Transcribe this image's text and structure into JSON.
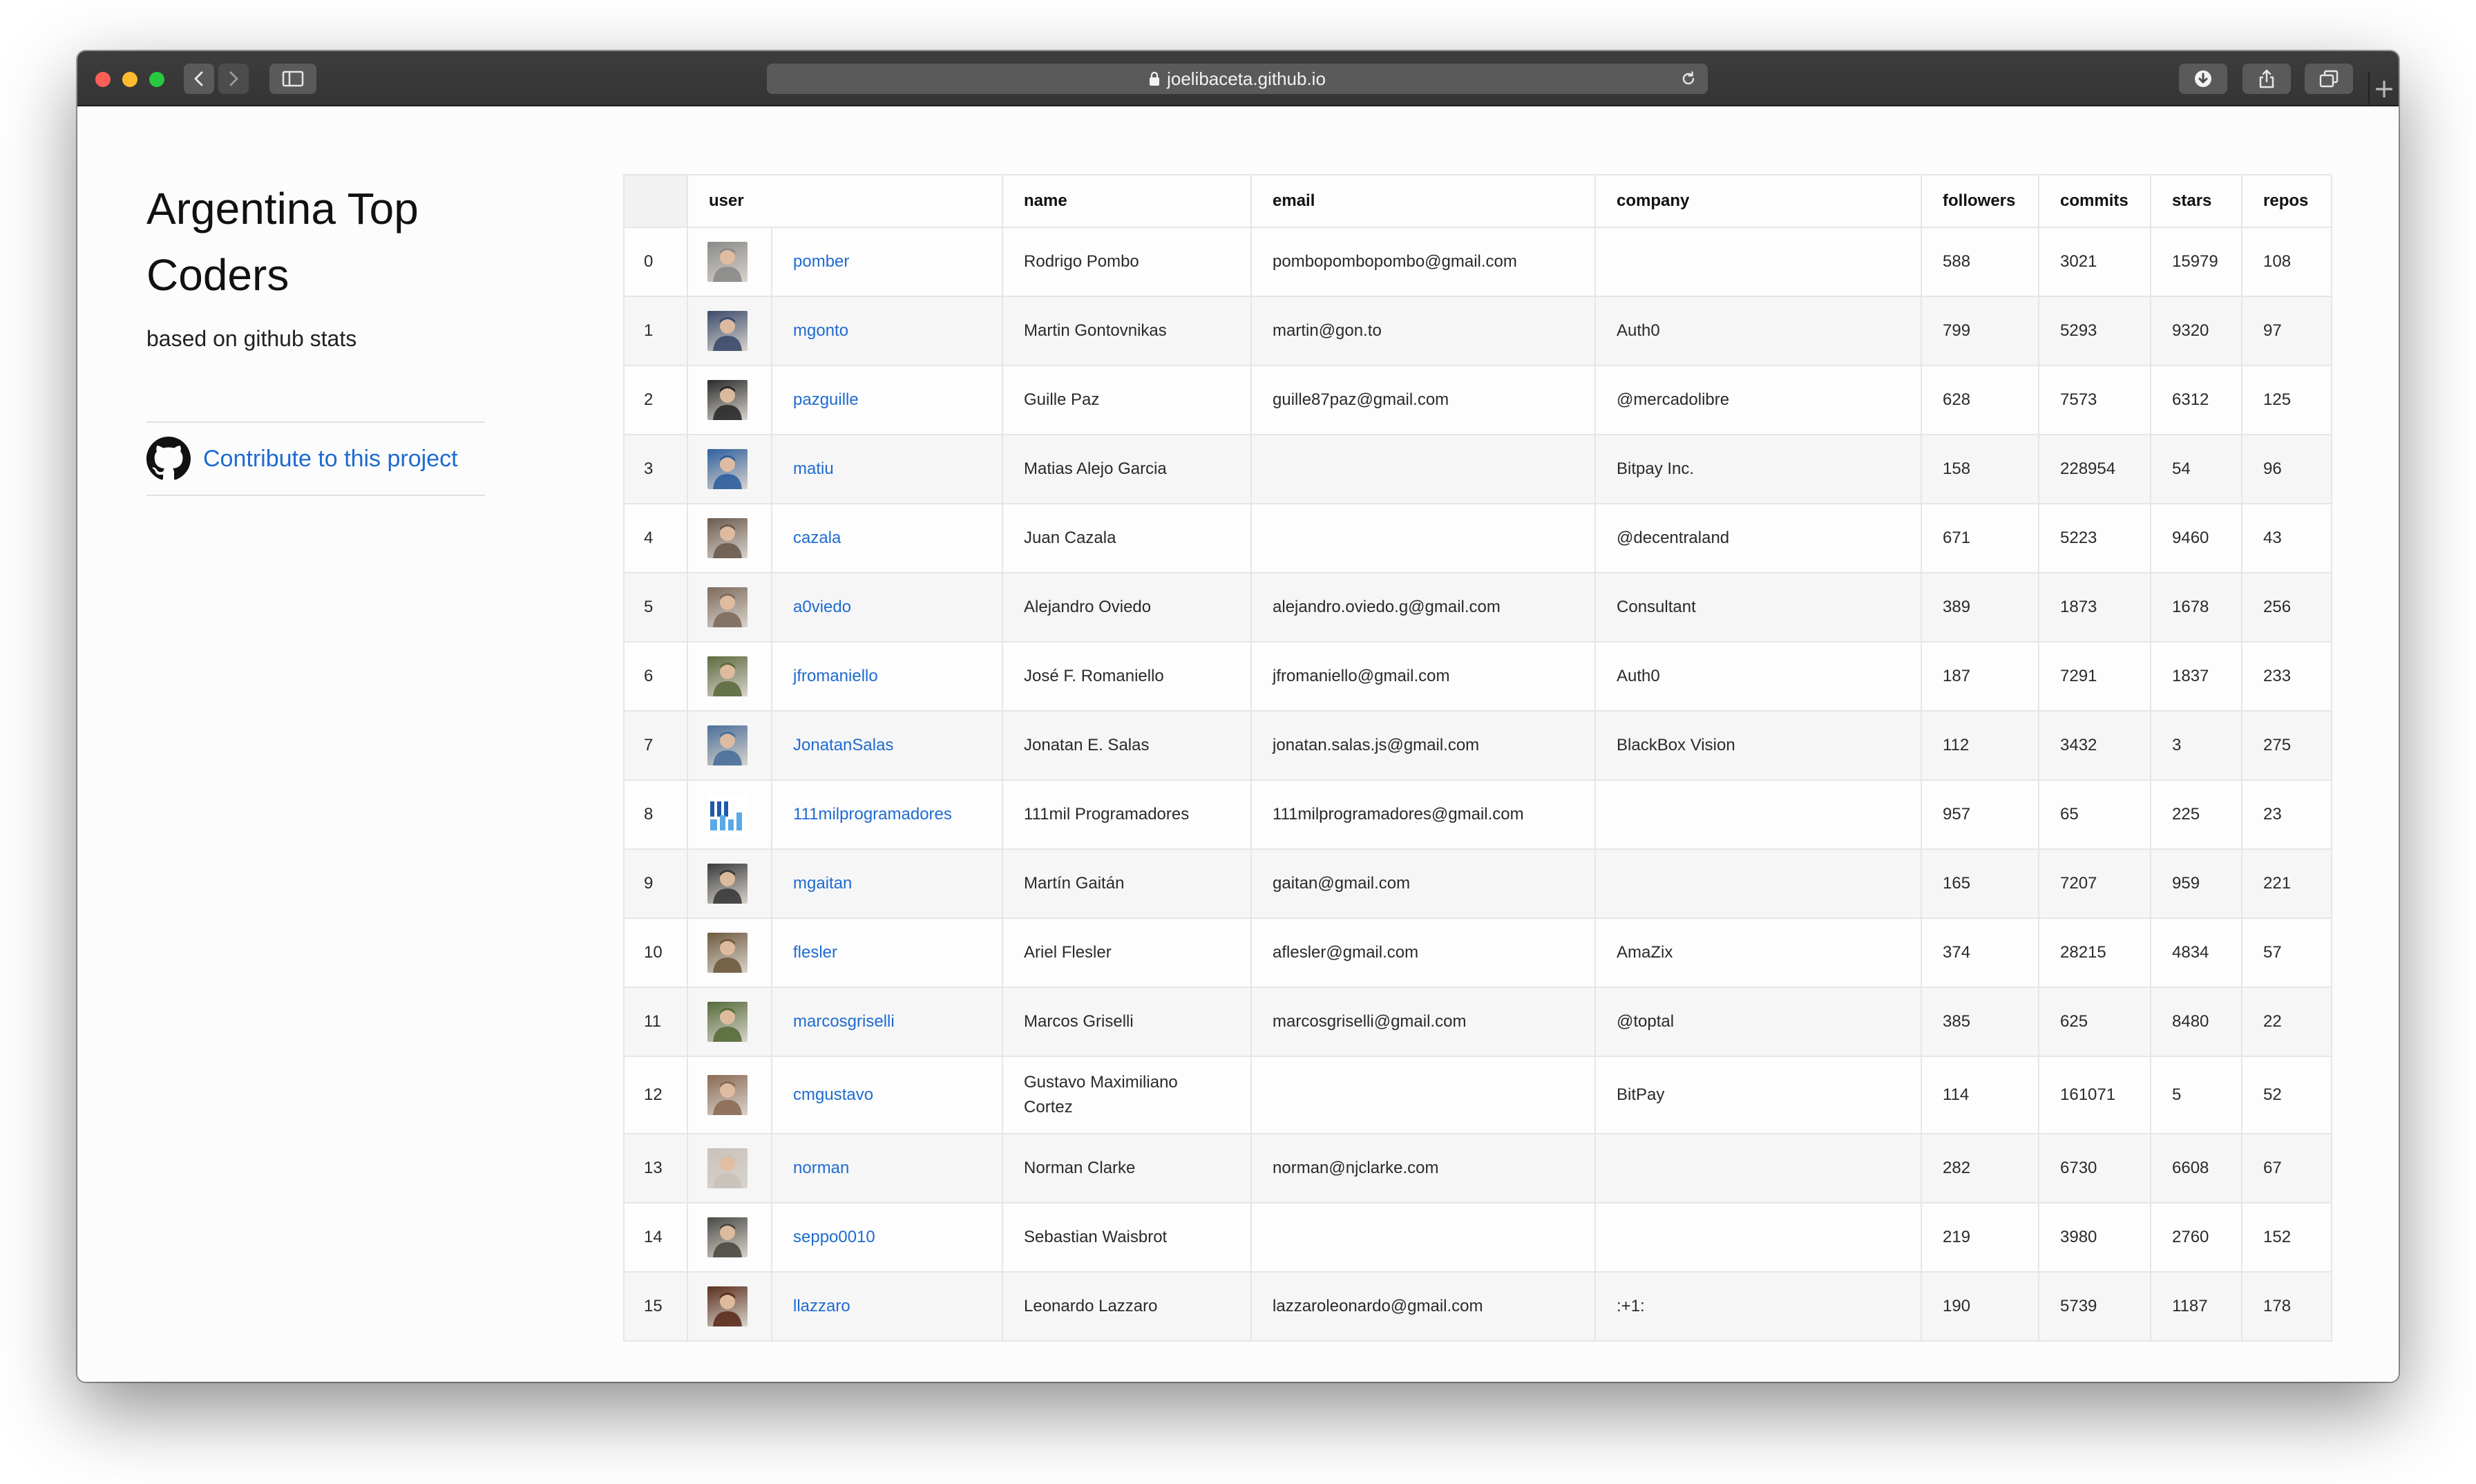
{
  "browser": {
    "url": "joelibaceta.github.io",
    "new_tab_label": "+"
  },
  "sidebar": {
    "title": "Argentina Top Coders",
    "subtitle": "based on github stats",
    "contribute_label": "Contribute to this project"
  },
  "table": {
    "headers": {
      "user": "user",
      "name": "name",
      "email": "email",
      "company": "company",
      "followers": "followers",
      "commits": "commits",
      "stars": "stars",
      "repos": "repos"
    },
    "rows": [
      {
        "idx": "0",
        "user": "pomber",
        "name": "Rodrigo Pombo",
        "email": "pombopombopombo@gmail.com",
        "company": "",
        "followers": "588",
        "commits": "3021",
        "stars": "15979",
        "repos": "108",
        "avatar_color": "#8a8a88"
      },
      {
        "idx": "1",
        "user": "mgonto",
        "name": "Martin Gontovnikas",
        "email": "martin@gon.to",
        "company": "Auth0",
        "followers": "799",
        "commits": "5293",
        "stars": "9320",
        "repos": "97",
        "avatar_color": "#3b4a6b"
      },
      {
        "idx": "2",
        "user": "pazguille",
        "name": "Guille Paz",
        "email": "guille87paz@gmail.com",
        "company": "@mercadolibre",
        "followers": "628",
        "commits": "7573",
        "stars": "6312",
        "repos": "125",
        "avatar_color": "#2a2a2a"
      },
      {
        "idx": "3",
        "user": "matiu",
        "name": "Matias Alejo Garcia",
        "email": "",
        "company": "Bitpay Inc.",
        "followers": "158",
        "commits": "228954",
        "stars": "54",
        "repos": "96",
        "avatar_color": "#2f5f9f"
      },
      {
        "idx": "4",
        "user": "cazala",
        "name": "Juan Cazala",
        "email": "",
        "company": "@decentraland",
        "followers": "671",
        "commits": "5223",
        "stars": "9460",
        "repos": "43",
        "avatar_color": "#6b5a4e"
      },
      {
        "idx": "5",
        "user": "a0viedo",
        "name": "Alejandro Oviedo",
        "email": "alejandro.oviedo.g@gmail.com",
        "company": "Consultant",
        "followers": "389",
        "commits": "1873",
        "stars": "1678",
        "repos": "256",
        "avatar_color": "#7d6a5c"
      },
      {
        "idx": "6",
        "user": "jfromaniello",
        "name": "José F. Romaniello",
        "email": "jfromaniello@gmail.com",
        "company": "Auth0",
        "followers": "187",
        "commits": "7291",
        "stars": "1837",
        "repos": "233",
        "avatar_color": "#5d6a3e"
      },
      {
        "idx": "7",
        "user": "JonatanSalas",
        "name": "Jonatan E. Salas",
        "email": "jonatan.salas.js@gmail.com",
        "company": "BlackBox Vision",
        "followers": "112",
        "commits": "3432",
        "stars": "3",
        "repos": "275",
        "avatar_color": "#4a6f9a"
      },
      {
        "idx": "8",
        "user": "111milprogramadores",
        "name": "111mil Programadores",
        "email": "111milprogramadores@gmail.com",
        "company": "",
        "followers": "957",
        "commits": "65",
        "stars": "225",
        "repos": "23",
        "avatar_color": "#1e5aa8"
      },
      {
        "idx": "9",
        "user": "mgaitan",
        "name": "Martín Gaitán",
        "email": "gaitan@gmail.com",
        "company": "",
        "followers": "165",
        "commits": "7207",
        "stars": "959",
        "repos": "221",
        "avatar_color": "#3a3a3a"
      },
      {
        "idx": "10",
        "user": "flesler",
        "name": "Ariel Flesler",
        "email": "aflesler@gmail.com",
        "company": "AmaZix",
        "followers": "374",
        "commits": "28215",
        "stars": "4834",
        "repos": "57",
        "avatar_color": "#6e5b3f"
      },
      {
        "idx": "11",
        "user": "marcosgriselli",
        "name": "Marcos Griselli",
        "email": "marcosgriselli@gmail.com",
        "company": "@toptal",
        "followers": "385",
        "commits": "625",
        "stars": "8480",
        "repos": "22",
        "avatar_color": "#556b3a"
      },
      {
        "idx": "12",
        "user": "cmgustavo",
        "name": "Gustavo Maximiliano Cortez",
        "email": "",
        "company": "BitPay",
        "followers": "114",
        "commits": "161071",
        "stars": "5",
        "repos": "52",
        "avatar_color": "#8b6a55"
      },
      {
        "idx": "13",
        "user": "norman",
        "name": "Norman Clarke",
        "email": "norman@njclarke.com",
        "company": "",
        "followers": "282",
        "commits": "6730",
        "stars": "6608",
        "repos": "67",
        "avatar_color": "#c9c2ba"
      },
      {
        "idx": "14",
        "user": "seppo0010",
        "name": "Sebastian Waisbrot",
        "email": "",
        "company": "",
        "followers": "219",
        "commits": "3980",
        "stars": "2760",
        "repos": "152",
        "avatar_color": "#4a4a44"
      },
      {
        "idx": "15",
        "user": "llazzaro",
        "name": "Leonardo Lazzaro",
        "email": "lazzaroleonardo@gmail.com",
        "company": ":+1:",
        "followers": "190",
        "commits": "5739",
        "stars": "1187",
        "repos": "178",
        "avatar_color": "#5a2e1c"
      }
    ]
  }
}
